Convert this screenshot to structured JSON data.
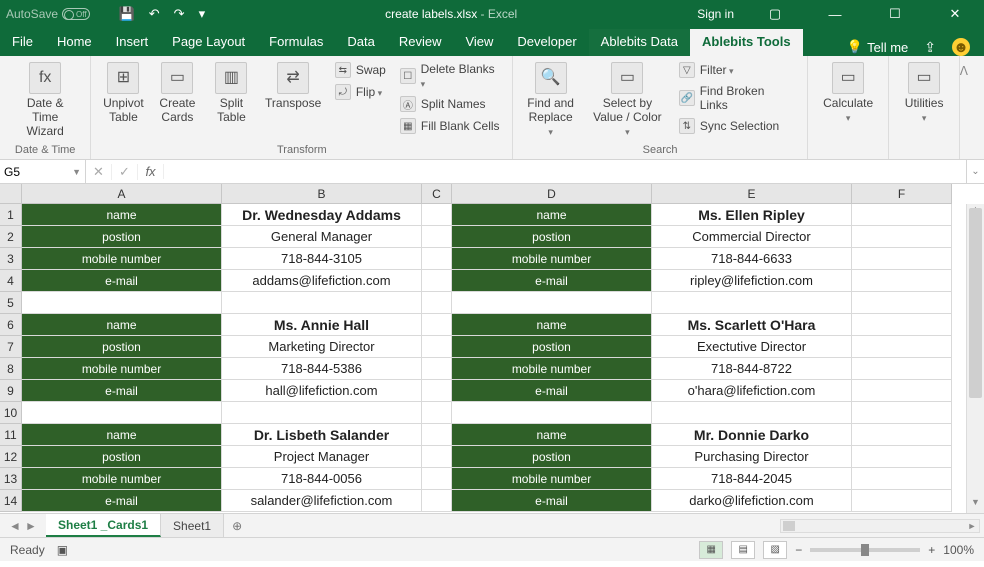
{
  "titlebar": {
    "autosave_label": "AutoSave",
    "autosave_off": "Off",
    "filename": "create labels.xlsx",
    "app_suffix": "  -  Excel",
    "signin": "Sign in"
  },
  "qat": {
    "save": "💾",
    "undo": "↶",
    "redo": "↷",
    "customize": "▾"
  },
  "tabs": {
    "file": "File",
    "list": [
      "Home",
      "Insert",
      "Page Layout",
      "Formulas",
      "Data",
      "Review",
      "View",
      "Developer",
      "Ablebits Data"
    ],
    "active": "Ablebits Tools",
    "tellme": "Tell me"
  },
  "ribbon": {
    "groups": {
      "datetime": {
        "label": "Date & Time",
        "buttons": [
          {
            "icon": "fx",
            "line1": "Date &",
            "line2": "Time Wizard"
          }
        ]
      },
      "transform": {
        "label": "Transform",
        "big": [
          {
            "icon": "⊞",
            "line1": "Unpivot",
            "line2": "Table"
          },
          {
            "icon": "▭",
            "line1": "Create",
            "line2": "Cards"
          },
          {
            "icon": "▥",
            "line1": "Split",
            "line2": "Table"
          },
          {
            "icon": "⇄",
            "line1": "Transpose",
            "line2": ""
          }
        ],
        "small": [
          {
            "icon": "⇆",
            "label": "Swap",
            "drop": false
          },
          {
            "icon": "⤾",
            "label": "Flip",
            "drop": true
          }
        ]
      },
      "transform2_small": [
        {
          "icon": "☐",
          "label": "Delete Blanks",
          "drop": true
        },
        {
          "icon": "Ⓐ",
          "label": "Split Names",
          "drop": false
        },
        {
          "icon": "▦",
          "label": "Fill Blank Cells",
          "drop": false
        }
      ],
      "search": {
        "label": "Search",
        "big": [
          {
            "icon": "🔍",
            "line1": "Find and",
            "line2": "Replace",
            "drop": true
          },
          {
            "icon": "▭",
            "line1": "Select by",
            "line2": "Value / Color",
            "drop": true
          }
        ],
        "small": [
          {
            "icon": "▽",
            "label": "Filter",
            "drop": true
          },
          {
            "icon": "🔗",
            "label": "Find Broken Links",
            "drop": false
          },
          {
            "icon": "⇅",
            "label": "Sync Selection",
            "drop": false
          }
        ]
      },
      "calculate": {
        "label": "",
        "big": [
          {
            "icon": "▭",
            "line1": "Calculate",
            "line2": "",
            "drop": true
          }
        ]
      },
      "utilities": {
        "label": "",
        "big": [
          {
            "icon": "▭",
            "line1": "Utilities",
            "line2": "",
            "drop": true
          }
        ]
      }
    },
    "collapse": "ᐱ"
  },
  "fbar": {
    "namebox_value": "G5",
    "fx_label": "fx",
    "formula": ""
  },
  "columns": [
    "A",
    "B",
    "C",
    "D",
    "E",
    "F"
  ],
  "row_headers": [
    1,
    2,
    3,
    4,
    5,
    6,
    7,
    8,
    9,
    10,
    11,
    12,
    13,
    14
  ],
  "chart_data": {
    "type": "table",
    "field_labels": [
      "name",
      "postion",
      "mobile number",
      "e-mail"
    ],
    "records": [
      [
        "Dr. Wednesday Addams",
        "General Manager",
        "718-844-3105",
        "addams@lifefiction.com"
      ],
      [
        "Ms. Ellen Ripley",
        "Commercial Director",
        "718-844-6633",
        "ripley@lifefiction.com"
      ],
      [
        "Ms. Annie Hall",
        "Marketing Director",
        "718-844-5386",
        "hall@lifefiction.com"
      ],
      [
        "Ms. Scarlett O'Hara",
        "Exectutive Director",
        "718-844-8722",
        "o'hara@lifefiction.com"
      ],
      [
        "Dr. Lisbeth Salander",
        "Project Manager",
        "718-844-0056",
        "salander@lifefiction.com"
      ],
      [
        "Mr. Donnie Darko",
        "Purchasing Director",
        "718-844-2045",
        "darko@lifefiction.com"
      ]
    ]
  },
  "sheets": {
    "active": "Sheet1 _Cards1",
    "others": [
      "Sheet1"
    ]
  },
  "statusbar": {
    "ready": "Ready",
    "zoom": "100%",
    "plus": "+",
    "minus": "−"
  }
}
